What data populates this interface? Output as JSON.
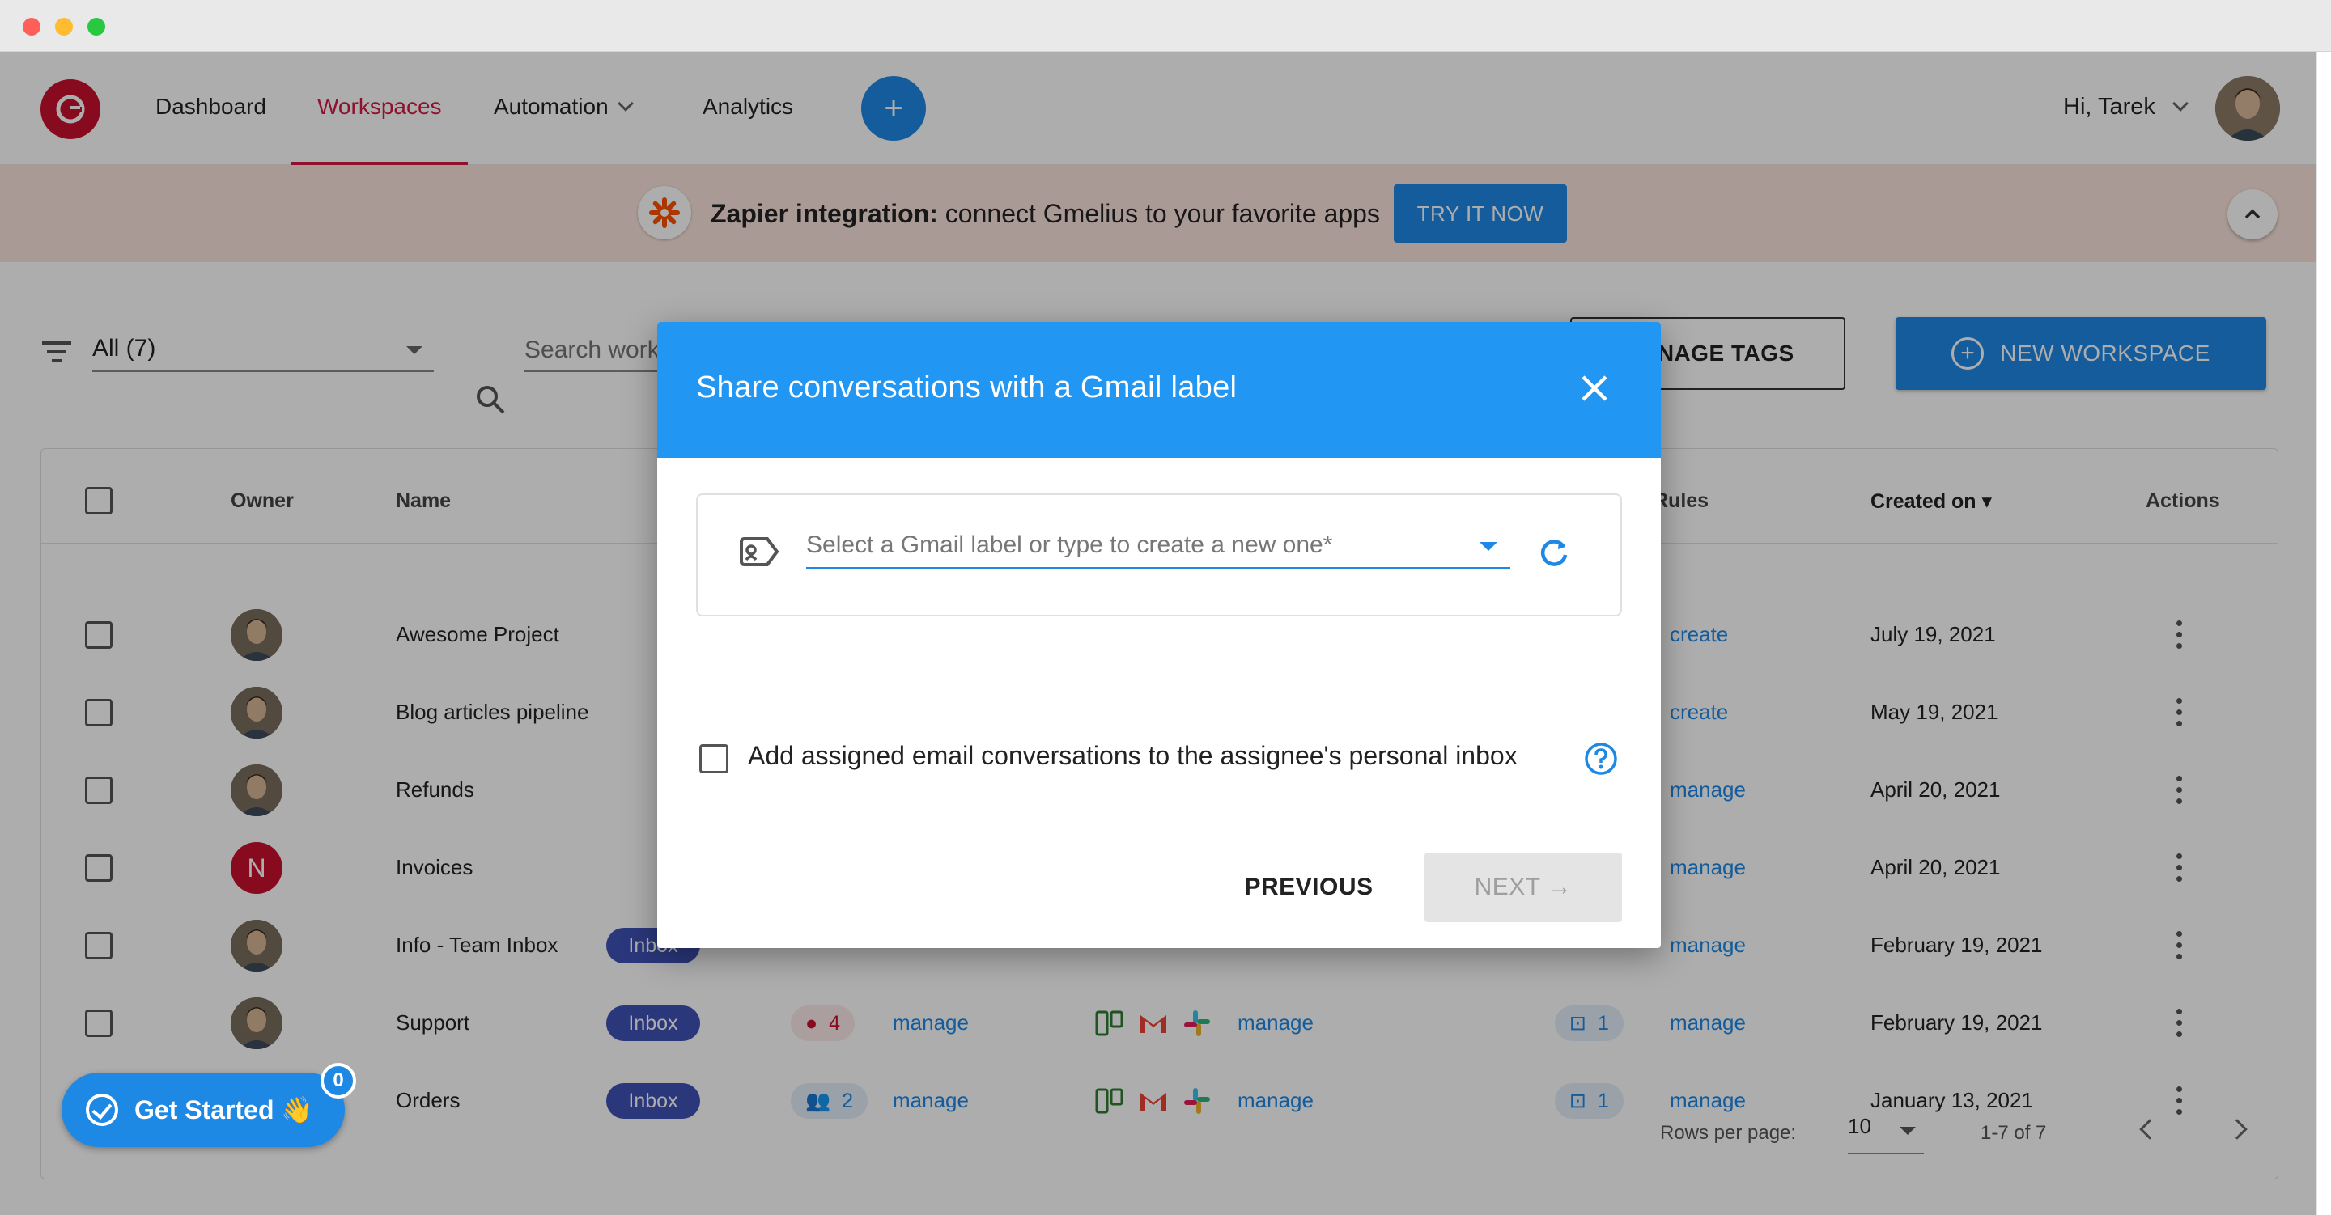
{
  "colors": {
    "brand": "#c8102e",
    "accent": "#1e88e5",
    "dialog_header": "#2196f3",
    "overlay": "rgba(0,0,0,0.32)"
  },
  "nav": {
    "items": [
      {
        "label": "Dashboard",
        "active": false
      },
      {
        "label": "Workspaces",
        "active": true
      },
      {
        "label": "Automation",
        "active": false,
        "has_dropdown": true
      },
      {
        "label": "Analytics",
        "active": false
      }
    ],
    "plus_label": "+",
    "greeting": "Hi, Tarek"
  },
  "banner": {
    "bold": "Zapier integration:",
    "text": " connect Gmelius to your favorite apps",
    "cta": "TRY IT NOW"
  },
  "toolbar": {
    "filter_value": "All (7)",
    "search_placeholder": "Search workspaces",
    "manage_tags": "MANAGE TAGS",
    "new_workspace": "NEW WORKSPACE"
  },
  "table": {
    "headers": {
      "owner": "Owner",
      "name": "Name",
      "rules": "Rules",
      "created": "Created on",
      "actions": "Actions"
    },
    "rows": [
      {
        "owner_letter": "",
        "name": "Awesome Project",
        "rules_link": "create",
        "created": "July 19, 2021"
      },
      {
        "owner_letter": "",
        "name": "Blog articles pipeline",
        "rules_link": "create",
        "created": "May 19, 2021"
      },
      {
        "owner_letter": "",
        "name": "Refunds",
        "rules_link": "manage",
        "created": "April 20, 2021"
      },
      {
        "owner_letter": "N",
        "name": "Invoices",
        "rules_link": "manage",
        "created": "April 20, 2021"
      },
      {
        "owner_letter": "",
        "name": "Info - Team Inbox",
        "chip": "Inbox",
        "rules_link": "manage",
        "created": "February 19, 2021"
      },
      {
        "owner_letter": "",
        "name": "Support",
        "chip": "Inbox",
        "members_count": "4",
        "members_link": "manage",
        "apps_link": "manage",
        "rules_count": "1",
        "rules_link": "manage",
        "created": "February 19, 2021"
      },
      {
        "owner_letter": "",
        "name": "Orders",
        "chip": "Inbox",
        "members_count": "2",
        "members_link": "manage",
        "apps_link": "manage",
        "rules_count": "1",
        "rules_link": "manage",
        "created": "January 13, 2021"
      }
    ],
    "pagination": {
      "rows_per_page_label": "Rows per page:",
      "rows_per_page": "10",
      "range": "1-7 of 7"
    }
  },
  "get_started": {
    "label": "Get Started 👋",
    "badge": "0"
  },
  "dialog": {
    "title": "Share conversations with a Gmail label",
    "label_placeholder": "Select a Gmail label or type to create a new one*",
    "checkbox_label": "Add assigned email conversations to the assignee's personal inbox",
    "previous": "PREVIOUS",
    "next": "NEXT →"
  }
}
